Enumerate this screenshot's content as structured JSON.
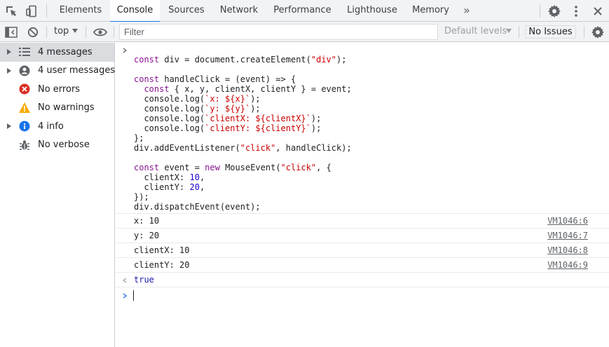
{
  "tabs": [
    {
      "label": "Elements"
    },
    {
      "label": "Console"
    },
    {
      "label": "Sources"
    },
    {
      "label": "Network"
    },
    {
      "label": "Performance"
    },
    {
      "label": "Lighthouse"
    },
    {
      "label": "Memory"
    }
  ],
  "more_tabs_glyph": "»",
  "toolbar": {
    "context": "top",
    "filter_placeholder": "Filter",
    "levels": "Default levels",
    "issues": "No Issues"
  },
  "sidebar": {
    "items": [
      {
        "label": "4 messages",
        "icon": "list-icon"
      },
      {
        "label": "4 user messages",
        "icon": "user-icon"
      },
      {
        "label": "No errors",
        "icon": "error-icon"
      },
      {
        "label": "No warnings",
        "icon": "warning-icon"
      },
      {
        "label": "4 info",
        "icon": "info-icon"
      },
      {
        "label": "No verbose",
        "icon": "bug-icon"
      }
    ]
  },
  "console": {
    "code_lines": [
      "const div = document.createElement(\"div\");",
      "",
      "const handleClick = (event) => {",
      "  const { x, y, clientX, clientY } = event;",
      "  console.log(`x: ${x}`);",
      "  console.log(`y: ${y}`);",
      "  console.log(`clientX: ${clientX}`);",
      "  console.log(`clientY: ${clientY}`);",
      "};",
      "div.addEventListener(\"click\", handleClick);",
      "",
      "const event = new MouseEvent(\"click\", {",
      "  clientX: 10,",
      "  clientY: 20,",
      "});",
      "div.dispatchEvent(event);"
    ],
    "logs": [
      {
        "text": "x: 10",
        "source": "VM1046:6"
      },
      {
        "text": "y: 20",
        "source": "VM1046:7"
      },
      {
        "text": "clientX: 10",
        "source": "VM1046:8"
      },
      {
        "text": "clientY: 20",
        "source": "VM1046:9"
      }
    ],
    "result": "true"
  },
  "colors": {
    "accent": "#1a73e8",
    "keyword": "#881391",
    "string": "#c80000",
    "number": "#1c00cf"
  }
}
